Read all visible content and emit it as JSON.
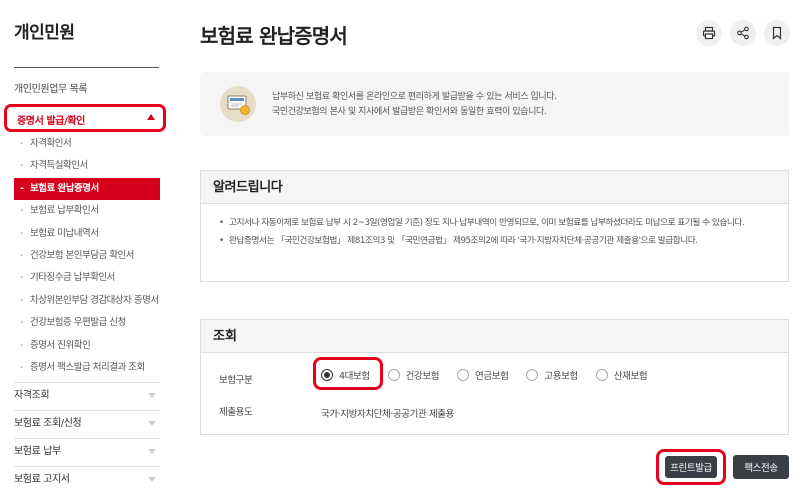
{
  "sidebar": {
    "title": "개인민원",
    "top_link": "개인민원업무 목록",
    "active_group": "증명서 발급/확인",
    "sub_items": [
      "자격확인서",
      "자격득실확인서",
      "보험료 완납증명서",
      "보험료 납부확인서",
      "보험료 미납내역서",
      "건강보험 본인부담금 확인서",
      "기타징수금 납부확인서",
      "차상위본인부담 경감대상자 증명서",
      "건강보험증 우편발급 신청",
      "증명서 진위확인",
      "증명서 팩스발급 처리결과 조회"
    ],
    "active_sub_index": 2,
    "sections": [
      "자격조회",
      "보험료 조회/신청",
      "보험료 납부",
      "보험료 고지서"
    ]
  },
  "header": {
    "title": "보험료 완납증명서",
    "icons": [
      "print-icon",
      "share-icon",
      "bookmark-icon"
    ]
  },
  "intro": {
    "line1": "납부하신 보험료 확인서를 온라인으로 편리하게 발급받을 수 있는 서비스 입니다.",
    "line2": "국민건강보험의 본사 및 지사에서 발급받은 확인서와 동일한 효력이 있습니다."
  },
  "notice": {
    "title": "알려드립니다",
    "items": [
      "고지서나 자동이체로 보험료 납부 시 2~3일(영업일 기준) 정도 지나 납부내역이 반영되므로, 이미 보험료를 납부하셨더라도 미납으로 표기될 수 있습니다.",
      "완납증명서는 「국민건강보험법」 제81조의3 및 「국민연금법」 제95조의2에 따라 '국가·지방자치단체·공공기관 제출용'으로 발급합니다."
    ]
  },
  "query": {
    "title": "조회",
    "insurance_label": "보험구분",
    "options": [
      "4대보험",
      "건강보험",
      "연금보험",
      "고용보험",
      "산재보험"
    ],
    "selected_index": 0,
    "purpose_label": "제출용도",
    "purpose_value": "국가·지방자치단체·공공기관 제출용"
  },
  "buttons": {
    "print": "프린트발급",
    "fax": "팩스전송"
  },
  "colors": {
    "accent": "#d6001c",
    "highlight": "#e8001c",
    "button": "#3a3f47"
  }
}
